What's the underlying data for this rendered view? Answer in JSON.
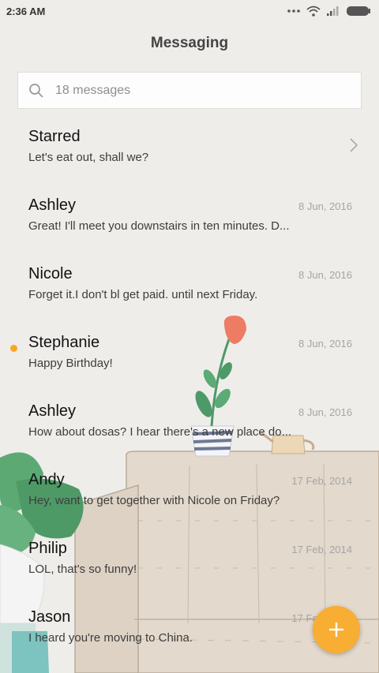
{
  "status_bar": {
    "time": "2:36 AM",
    "icons": [
      "more-dots-icon",
      "wifi-icon",
      "signal-icon",
      "battery-icon"
    ]
  },
  "header": {
    "title": "Messaging"
  },
  "search": {
    "placeholder": "18 messages",
    "icon": "search-icon"
  },
  "conversations": [
    {
      "name": "Starred",
      "preview": "Let's eat out, shall we?",
      "date": "",
      "unread": false,
      "chevron": true
    },
    {
      "name": "Ashley",
      "preview": "Great! I'll meet you downstairs in ten minutes. D...",
      "date": "8 Jun, 2016",
      "unread": false
    },
    {
      "name": "Nicole",
      "preview": "Forget it.I don't bl get paid. until next Friday.",
      "date": "8 Jun, 2016",
      "unread": false
    },
    {
      "name": "Stephanie",
      "preview": "Happy Birthday!",
      "date": "8 Jun, 2016",
      "unread": true
    },
    {
      "name": "Ashley",
      "preview": "How about dosas? I hear there's a new place do...",
      "date": "8 Jun, 2016",
      "unread": false
    },
    {
      "name": "Andy",
      "preview": "Hey, want to get together with Nicole on Friday?",
      "date": "17 Feb, 2014",
      "unread": false
    },
    {
      "name": "Philip",
      "preview": "LOL, that's so funny!",
      "date": "17 Feb, 2014",
      "unread": false
    },
    {
      "name": "Jason",
      "preview": "I heard you're moving to China.",
      "date": "17 Feb, 2014",
      "unread": false
    }
  ],
  "fab": {
    "icon": "plus-icon"
  },
  "colors": {
    "accent": "#f8ad33",
    "unread_dot": "#f7a624",
    "background": "#efedea"
  }
}
